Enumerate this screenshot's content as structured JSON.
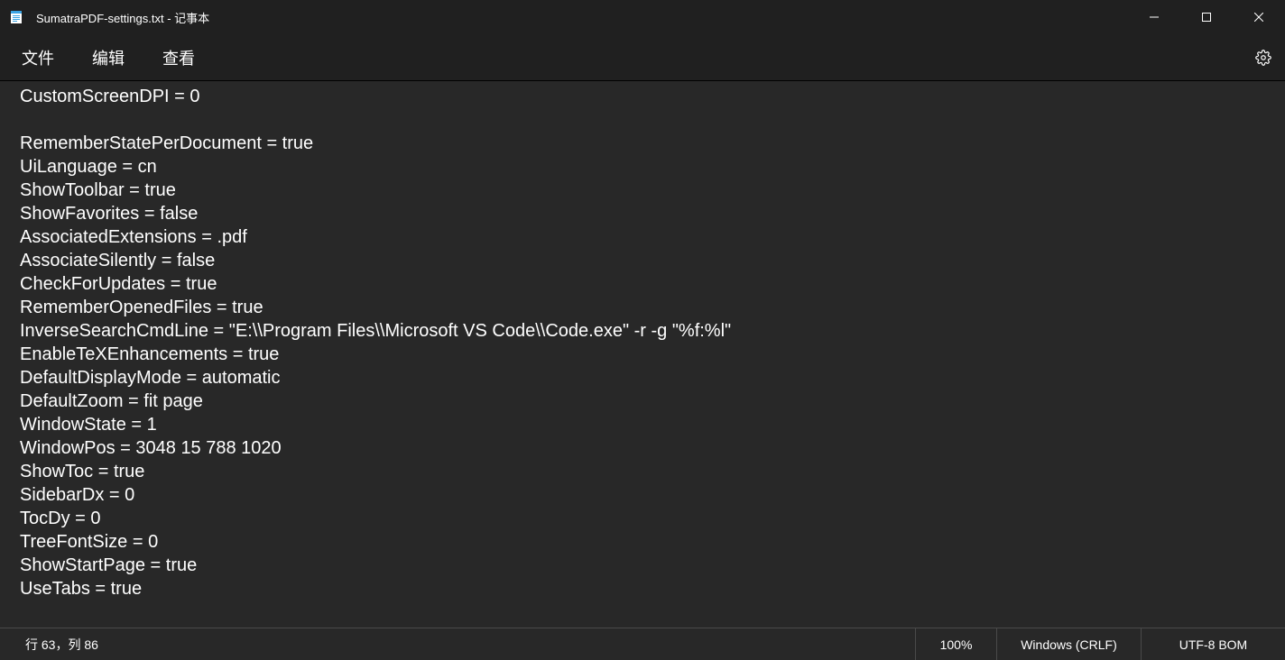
{
  "window": {
    "title": "SumatraPDF-settings.txt - 记事本"
  },
  "menu": {
    "file": "文件",
    "edit": "编辑",
    "view": "查看"
  },
  "editor": {
    "content": "CustomScreenDPI = 0\n\nRememberStatePerDocument = true\nUiLanguage = cn\nShowToolbar = true\nShowFavorites = false\nAssociatedExtensions = .pdf\nAssociateSilently = false\nCheckForUpdates = true\nRememberOpenedFiles = true\nInverseSearchCmdLine = \"E:\\\\Program Files\\\\Microsoft VS Code\\\\Code.exe\" -r -g \"%f:%l\"\nEnableTeXEnhancements = true\nDefaultDisplayMode = automatic\nDefaultZoom = fit page\nWindowState = 1\nWindowPos = 3048 15 788 1020\nShowToc = true\nSidebarDx = 0\nTocDy = 0\nTreeFontSize = 0\nShowStartPage = true\nUseTabs = true"
  },
  "status": {
    "position": "行 63，列 86",
    "zoom": "100%",
    "line_ending": "Windows (CRLF)",
    "encoding": "UTF-8 BOM"
  }
}
